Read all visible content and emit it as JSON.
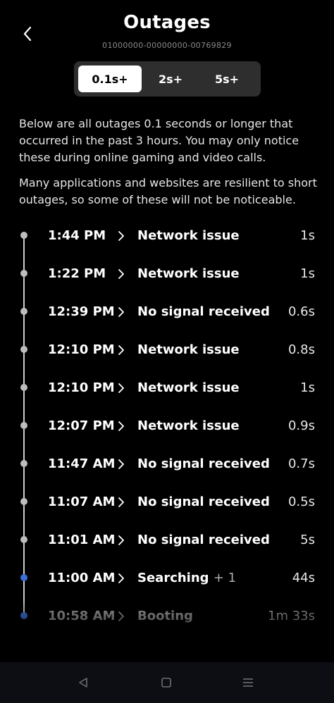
{
  "header": {
    "title": "Outages",
    "serial": "01000000-00000000-00769829"
  },
  "filter": {
    "options": [
      "0.1s+",
      "2s+",
      "5s+"
    ],
    "selected": "0.1s+"
  },
  "intro": {
    "paragraph1": "Below are all outages 0.1 seconds or longer that occurred in the past 3 hours. You may only notice these during online gaming and video calls.",
    "paragraph2": "Many applications and websites are resilient to short outages, so some of these will not be noticeable."
  },
  "outages": [
    {
      "time": "1:44 PM",
      "reason": "Network issue",
      "extra": "",
      "duration": "1s",
      "dot": "gray"
    },
    {
      "time": "1:22 PM",
      "reason": "Network issue",
      "extra": "",
      "duration": "1s",
      "dot": "gray"
    },
    {
      "time": "12:39 PM",
      "reason": "No signal received",
      "extra": "",
      "duration": "0.6s",
      "dot": "gray"
    },
    {
      "time": "12:10 PM",
      "reason": "Network issue",
      "extra": "",
      "duration": "0.8s",
      "dot": "gray"
    },
    {
      "time": "12:10 PM",
      "reason": "Network issue",
      "extra": "",
      "duration": "1s",
      "dot": "gray"
    },
    {
      "time": "12:07 PM",
      "reason": "Network issue",
      "extra": "",
      "duration": "0.9s",
      "dot": "gray"
    },
    {
      "time": "11:47 AM",
      "reason": "No signal received",
      "extra": "",
      "duration": "0.7s",
      "dot": "gray"
    },
    {
      "time": "11:07 AM",
      "reason": "No signal received",
      "extra": "",
      "duration": "0.5s",
      "dot": "gray"
    },
    {
      "time": "11:01 AM",
      "reason": "No signal received",
      "extra": "",
      "duration": "5s",
      "dot": "gray"
    },
    {
      "time": "11:00 AM",
      "reason": "Searching",
      "extra": "+ 1",
      "duration": "44s",
      "dot": "blue"
    },
    {
      "time": "10:58 AM",
      "reason": "Booting",
      "extra": "",
      "duration": "1m 33s",
      "dot": "blue"
    }
  ],
  "colors": {
    "background": "#000000",
    "accent_dot": "#3a6fd8",
    "segment_bg": "#2e2e2e"
  },
  "icons": {
    "back": "chevron-left-icon",
    "row_chevron": "chevron-right-icon",
    "nav_back": "triangle-back-icon",
    "nav_home": "square-home-icon",
    "nav_menu": "hamburger-menu-icon"
  }
}
